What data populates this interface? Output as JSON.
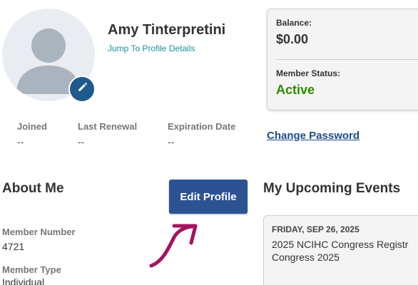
{
  "profile": {
    "name": "Amy Tinterpretini",
    "jump_link": "Jump To Profile Details"
  },
  "balance_card": {
    "balance_label": "Balance:",
    "balance_value": "$0.00",
    "status_label": "Member Status:",
    "status_value": "Active",
    "status_color": "#2e8b00"
  },
  "dates": [
    {
      "label": "Joined",
      "value": "--"
    },
    {
      "label": "Last Renewal",
      "value": "--"
    },
    {
      "label": "Expiration Date",
      "value": "--"
    }
  ],
  "change_password": "Change Password",
  "about": {
    "heading": "About Me",
    "edit_button": "Edit Profile",
    "fields": [
      {
        "label": "Member Number",
        "value": "4721"
      },
      {
        "label": "Member Type",
        "value": "Individual"
      }
    ]
  },
  "events": {
    "heading": "My Upcoming Events",
    "items": [
      {
        "date": "FRIDAY, SEP 26, 2025",
        "title": "2025 NCIHC Congress Registr\nCongress 2025"
      }
    ]
  },
  "colors": {
    "accent_button": "#2d5294",
    "link": "#1f8c9c",
    "annotation_arrow": "#a4145f"
  },
  "icons": {
    "avatar": "person-silhouette",
    "edit": "pencil-icon"
  }
}
